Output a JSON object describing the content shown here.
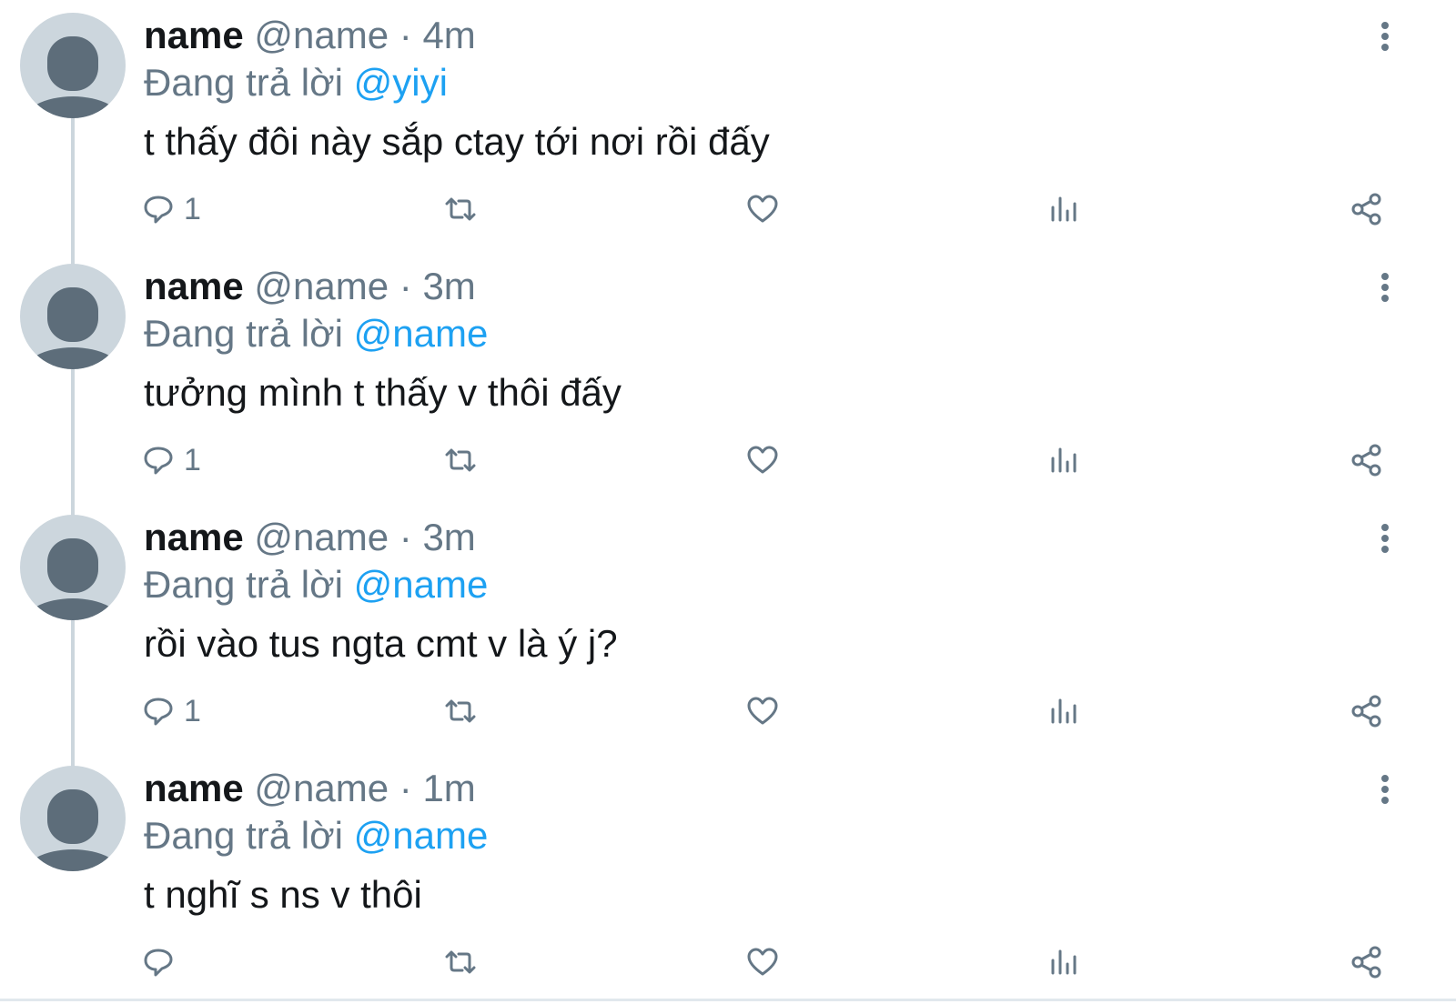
{
  "colors": {
    "text": "#14171a",
    "secondary": "#657786",
    "mention": "#1da1f2",
    "avatar_bg": "#ccd6dd",
    "avatar_fg": "#5d6d7a"
  },
  "icons": {
    "reply": "reply-icon",
    "retweet": "retweet-icon",
    "like": "like-icon",
    "stats": "stats-icon",
    "share": "share-icon",
    "more": "more-icon"
  },
  "tweets": [
    {
      "display_name": "name",
      "handle": "@name",
      "separator": "·",
      "time": "4m",
      "replying_label": "Đang trả lời ",
      "replying_to": "@yiyi",
      "text": "t thấy đôi này sắp ctay tới nơi rồi đấy",
      "reply_count": "1"
    },
    {
      "display_name": "name",
      "handle": "@name",
      "separator": "·",
      "time": "3m",
      "replying_label": "Đang trả lời ",
      "replying_to": "@name",
      "text": "tưởng mình t thấy v thôi đấy",
      "reply_count": "1"
    },
    {
      "display_name": "name",
      "handle": "@name",
      "separator": "·",
      "time": "3m",
      "replying_label": "Đang trả lời ",
      "replying_to": "@name",
      "text": "rồi vào tus ngta cmt v là ý j?",
      "reply_count": "1"
    },
    {
      "display_name": "name",
      "handle": "@name",
      "separator": "·",
      "time": "1m",
      "replying_label": "Đang trả lời ",
      "replying_to": "@name",
      "text": "t nghĩ s ns v thôi",
      "reply_count": ""
    }
  ]
}
